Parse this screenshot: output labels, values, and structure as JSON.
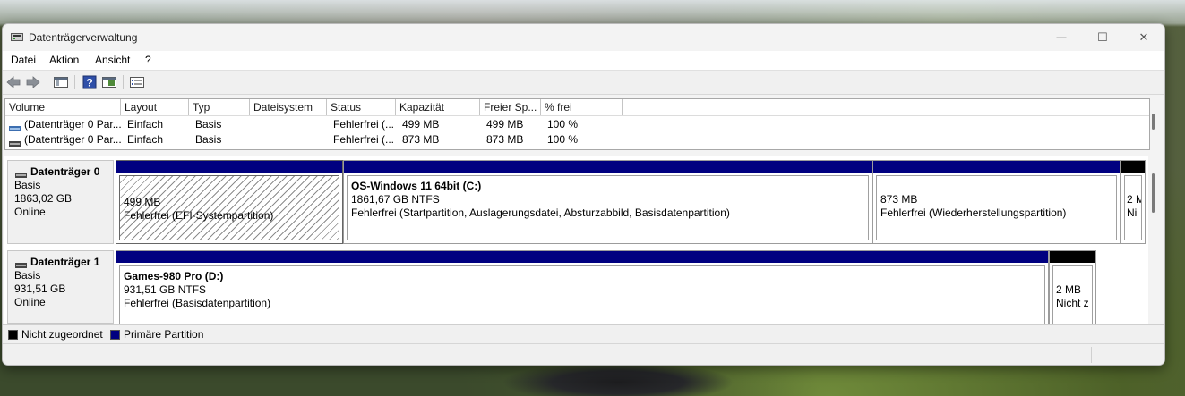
{
  "window": {
    "title": "Datenträgerverwaltung",
    "minimize_glyph": "—",
    "maximize_glyph": "☐",
    "close_glyph": "✕"
  },
  "menu": [
    "Datei",
    "Aktion",
    "Ansicht",
    "?"
  ],
  "toolbar": {
    "icons": [
      "back-icon",
      "forward-icon",
      "console-tree-icon",
      "help-icon",
      "view-icon",
      "properties-icon"
    ]
  },
  "volume_list": {
    "columns": [
      "Volume",
      "Layout",
      "Typ",
      "Dateisystem",
      "Status",
      "Kapazität",
      "Freier Sp...",
      "% frei"
    ],
    "rows": [
      [
        "(Datenträger 0 Par...",
        "Einfach",
        "Basis",
        "",
        "Fehlerfrei (...",
        "499 MB",
        "499 MB",
        "100 %"
      ],
      [
        "(Datenträger 0 Par...",
        "Einfach",
        "Basis",
        "",
        "Fehlerfrei (...",
        "873 MB",
        "873 MB",
        "100 %"
      ]
    ]
  },
  "disks": [
    {
      "name": "Datenträger 0",
      "type": "Basis",
      "size": "1863,02 GB",
      "status": "Online",
      "partitions": [
        {
          "title": "",
          "line1": "499 MB",
          "line2": "Fehlerfrei (EFI-Systempartition)",
          "kind": "primary",
          "selected": true
        },
        {
          "title": "OS-Windows 11 64bit  (C:)",
          "line1": "1861,67 GB NTFS",
          "line2": "Fehlerfrei (Startpartition, Auslagerungsdatei, Absturzabbild, Basisdatenpartition)",
          "kind": "primary"
        },
        {
          "title": "",
          "line1": "873 MB",
          "line2": "Fehlerfrei (Wiederherstellungspartition)",
          "kind": "primary"
        },
        {
          "title": "",
          "line1": "2 M",
          "line2": "Ni",
          "kind": "unallocated"
        }
      ]
    },
    {
      "name": "Datenträger 1",
      "type": "Basis",
      "size": "931,51 GB",
      "status": "Online",
      "partitions": [
        {
          "title": "Games-980 Pro  (D:)",
          "line1": "931,51 GB NTFS",
          "line2": "Fehlerfrei (Basisdatenpartition)",
          "kind": "primary"
        },
        {
          "title": "",
          "line1": "2 MB",
          "line2": "Nicht z",
          "kind": "unallocated"
        }
      ]
    }
  ],
  "legend": [
    {
      "label": "Nicht zugeordnet",
      "color": "#000000"
    },
    {
      "label": "Primäre Partition",
      "color": "#000080"
    }
  ],
  "colors": {
    "primary_bar": "#000080",
    "unallocated_bar": "#000000"
  }
}
